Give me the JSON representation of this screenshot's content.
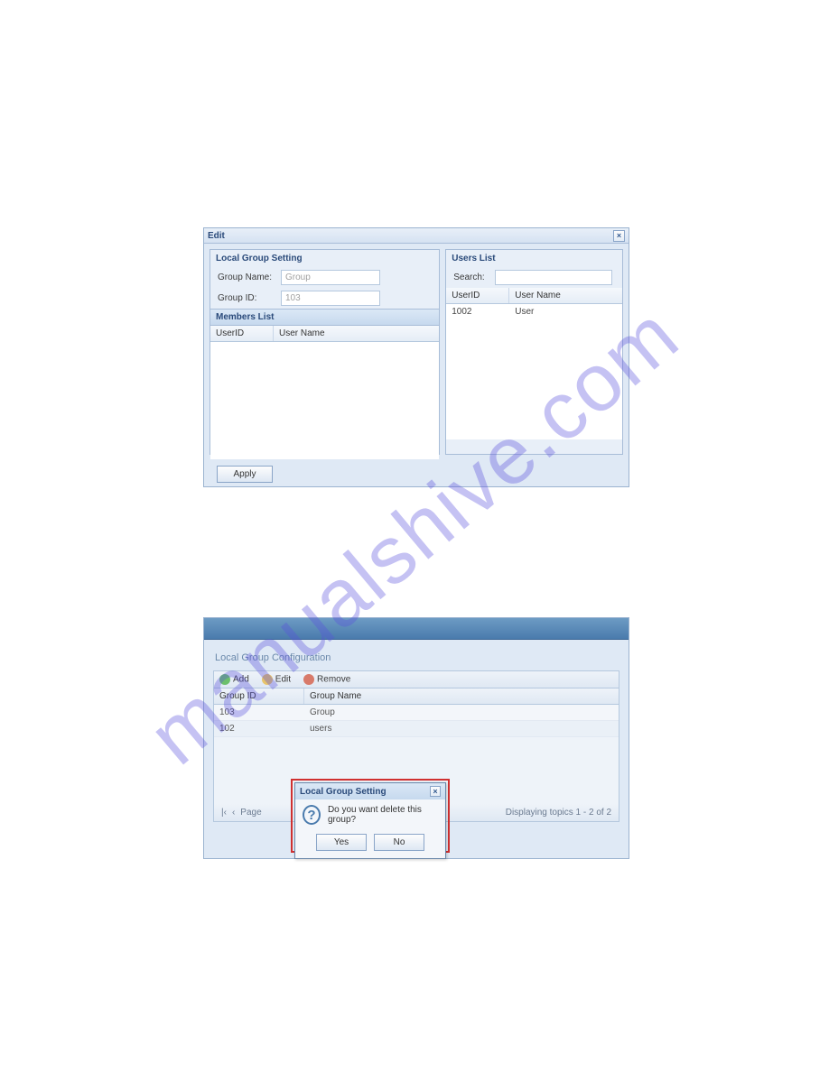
{
  "watermark": "manualshive.com",
  "shot1": {
    "title": "Edit",
    "localGroupSetting": {
      "legend": "Local Group Setting",
      "groupNameLabel": "Group Name:",
      "groupNameValue": "Group",
      "groupIdLabel": "Group ID:",
      "groupIdValue": "103",
      "membersListLabel": "Members List",
      "col_userid": "UserID",
      "col_username": "User Name"
    },
    "usersList": {
      "legend": "Users List",
      "searchLabel": "Search:",
      "col_userid": "UserID",
      "col_username": "User Name",
      "rows": [
        {
          "id": "1002",
          "name": "User"
        }
      ]
    },
    "applyLabel": "Apply"
  },
  "shot2": {
    "cfgTitle": "Local Group Configuration",
    "toolbar": {
      "add": "Add",
      "edit": "Edit",
      "remove": "Remove"
    },
    "grid": {
      "col_gid": "Group ID",
      "col_gname": "Group Name",
      "rows": [
        {
          "id": "103",
          "name": "Group"
        },
        {
          "id": "102",
          "name": "users"
        }
      ]
    },
    "pager": {
      "pageLabel": "Page",
      "displaying": "Displaying topics 1 - 2 of 2"
    },
    "dialog": {
      "title": "Local Group Setting",
      "message": "Do you want delete this group?",
      "yes": "Yes",
      "no": "No"
    }
  }
}
